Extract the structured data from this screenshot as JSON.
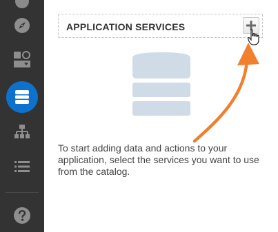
{
  "sidebar": {
    "items": [
      {
        "icon": "compass-icon",
        "active": false
      },
      {
        "icon": "layout-components-icon",
        "active": false
      },
      {
        "icon": "database-icon",
        "active": true
      },
      {
        "icon": "sitemap-icon",
        "active": false
      },
      {
        "icon": "list-icon",
        "active": false
      },
      {
        "icon": "help-icon",
        "active": false
      }
    ]
  },
  "panel": {
    "title": "APPLICATION SERVICES",
    "add_button_symbol": "+"
  },
  "empty_state": {
    "message": "To start adding data and actions to your application, select the services you want to use from the catalog."
  },
  "colors": {
    "sidebar_bg": "#333333",
    "active_accent": "#0e72cc",
    "arrow": "#f07f2e",
    "illustration": "#cfdbe7"
  }
}
